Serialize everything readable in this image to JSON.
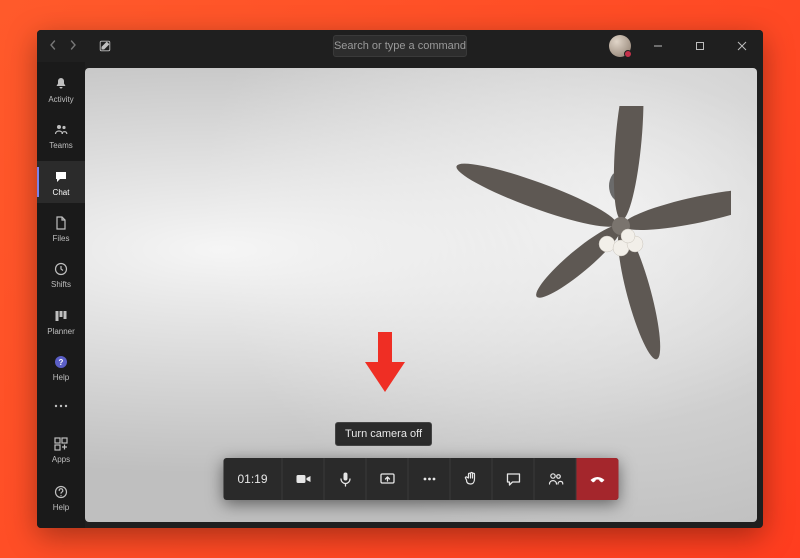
{
  "search": {
    "placeholder": "Search or type a command"
  },
  "rail": {
    "items": [
      {
        "label": "Activity"
      },
      {
        "label": "Teams"
      },
      {
        "label": "Chat"
      },
      {
        "label": "Files"
      },
      {
        "label": "Shifts"
      },
      {
        "label": "Planner"
      },
      {
        "label": "Help"
      }
    ],
    "selected_index": 2,
    "bottom": [
      {
        "label": "Apps"
      },
      {
        "label": "Help"
      }
    ]
  },
  "meeting": {
    "duration": "01:19",
    "tooltip": "Turn camera off",
    "buttons": {
      "camera": "Camera",
      "mic": "Mic",
      "share": "Share",
      "more": "More actions",
      "raise_hand": "Raise hand",
      "chat": "Show conversation",
      "people": "Show participants",
      "hangup": "Hang up"
    }
  }
}
